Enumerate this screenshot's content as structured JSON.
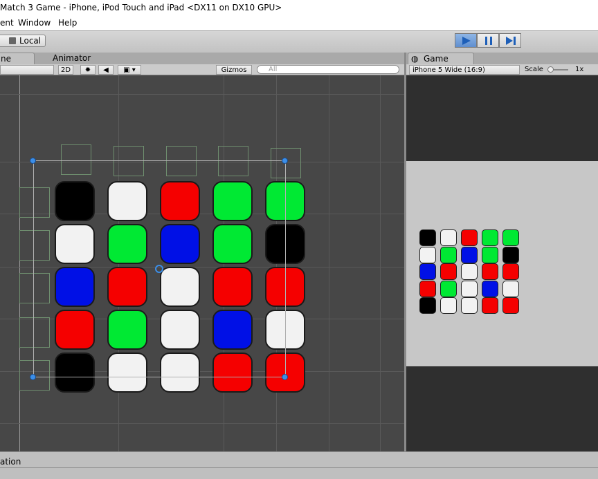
{
  "window": {
    "title": "Match 3 Game - iPhone, iPod Touch and iPad <DX11 on DX10 GPU>"
  },
  "menu": [
    {
      "label": "ent"
    },
    {
      "label": "Window"
    },
    {
      "label": "Help"
    }
  ],
  "toolbar": {
    "pivot_label": "Local"
  },
  "scene": {
    "tabs": [
      {
        "label": "ne"
      },
      {
        "label": "Animator"
      }
    ],
    "toolbar": {
      "mode_2d": "2D",
      "gizmos": "Gizmos",
      "search_placeholder": "All"
    },
    "board": [
      [
        "black",
        "white",
        "red",
        "green",
        "green"
      ],
      [
        "white",
        "green",
        "blue",
        "green",
        "black"
      ],
      [
        "blue",
        "red",
        "white",
        "red",
        "red"
      ],
      [
        "red",
        "green",
        "white",
        "blue",
        "white"
      ],
      [
        "black",
        "white",
        "white",
        "red",
        "red"
      ]
    ]
  },
  "game": {
    "tab": "Game",
    "resolution": "iPhone 5 Wide (16:9)",
    "scale_label": "Scale",
    "scale_value": "1x",
    "board": [
      [
        "black",
        "white",
        "red",
        "green",
        "green"
      ],
      [
        "white",
        "green",
        "blue",
        "green",
        "black"
      ],
      [
        "blue",
        "red",
        "white",
        "red",
        "red"
      ],
      [
        "red",
        "green",
        "white",
        "blue",
        "white"
      ],
      [
        "black",
        "white",
        "white",
        "red",
        "red"
      ]
    ]
  },
  "status": {
    "text": "ation"
  },
  "colors": {
    "black": "#000000",
    "white": "#f2f2f2",
    "red": "#f50000",
    "green": "#00e933",
    "blue": "#0010e6",
    "play_active": "#5f8fcf"
  }
}
